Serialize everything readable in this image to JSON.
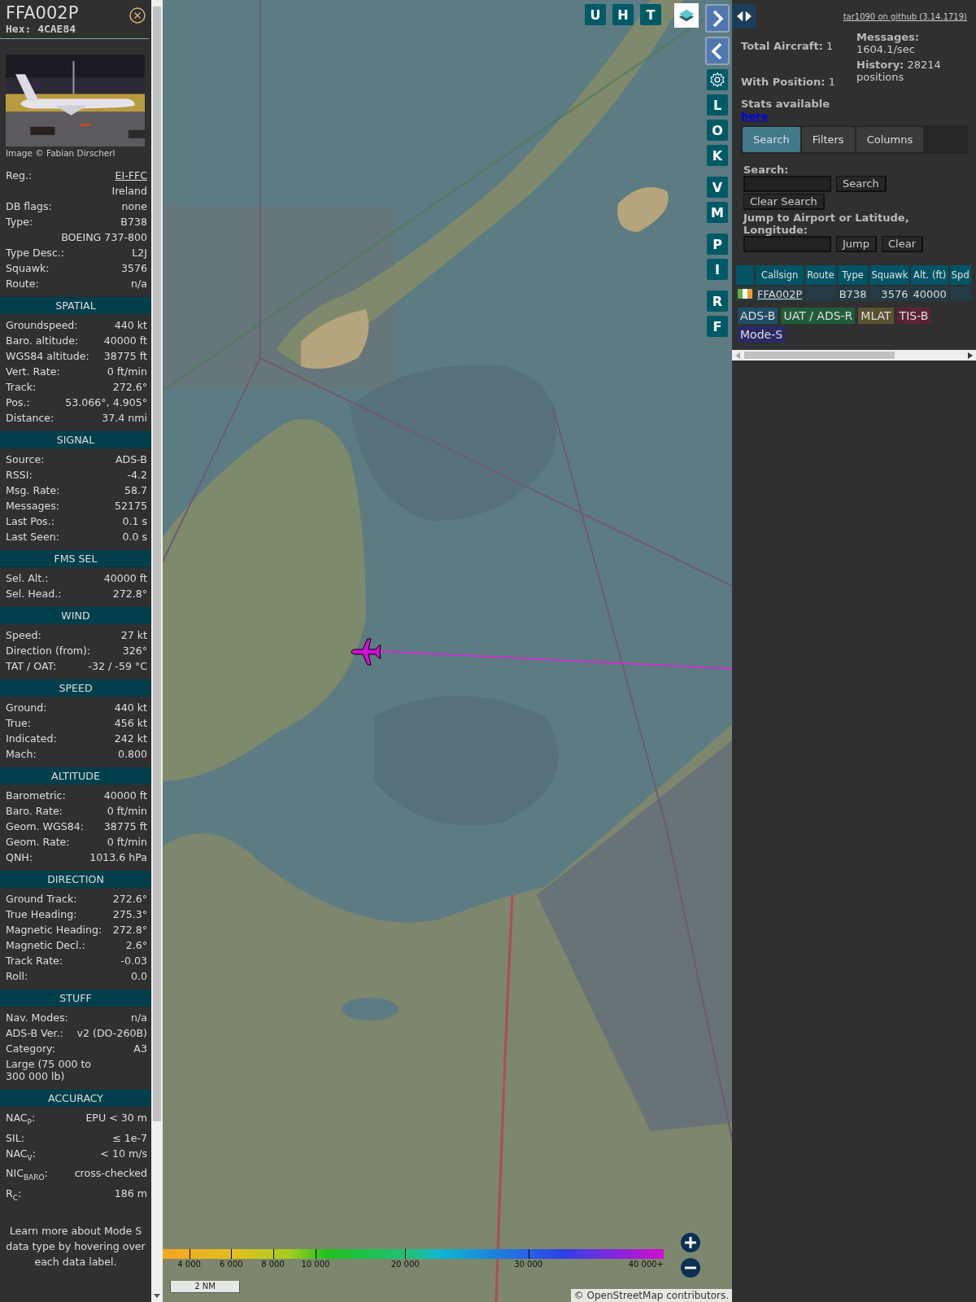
{
  "sidebar": {
    "callsign": "FFA002P",
    "hex_label": "Hex:",
    "hex": "4CAE84",
    "photo": {
      "kind": "picture"
    },
    "photo_credit": "Image © Fabian Dirscherl",
    "info_rows": [
      {
        "kind": "link",
        "label": "Reg.:",
        "value": "EI-FFC"
      },
      {
        "kind": "value",
        "value": "Ireland"
      },
      {
        "kind": "pair",
        "label": "DB flags:",
        "value": "none"
      },
      {
        "kind": "pair",
        "label": "Type:",
        "value": "B738"
      },
      {
        "kind": "value",
        "value": "BOEING 737-800"
      },
      {
        "kind": "pair",
        "label": "Type Desc.:",
        "value": "L2J"
      },
      {
        "kind": "pair",
        "label": "Squawk:",
        "value": "3576"
      },
      {
        "kind": "pair",
        "label": "Route:",
        "value": "n/a"
      }
    ],
    "sections": [
      {
        "title": "SPATIAL",
        "rows": [
          {
            "kind": "pair",
            "label": "Groundspeed:",
            "value": "440 kt"
          },
          {
            "kind": "pair",
            "label": "Baro. altitude:",
            "value": "40000 ft"
          },
          {
            "kind": "pair",
            "label": "WGS84 altitude:",
            "value": "38775 ft"
          },
          {
            "kind": "pair",
            "label": "Vert. Rate:",
            "value": "0 ft/min"
          },
          {
            "kind": "pair",
            "label": "Track:",
            "value": "272.6°"
          },
          {
            "kind": "pair",
            "label": "Pos.:",
            "value": "53.066°, 4.905°"
          },
          {
            "kind": "pair",
            "label": "Distance:",
            "value": "37.4 nmi"
          }
        ]
      },
      {
        "title": "SIGNAL",
        "rows": [
          {
            "kind": "pair",
            "label": "Source:",
            "value": "ADS-B"
          },
          {
            "kind": "pair",
            "label": "RSSI:",
            "value": "-4.2"
          },
          {
            "kind": "pair",
            "label": "Msg. Rate:",
            "value": "58.7"
          },
          {
            "kind": "pair",
            "label": "Messages:",
            "value": "52175"
          },
          {
            "kind": "pair",
            "label": "Last Pos.:",
            "value": "0.1 s"
          },
          {
            "kind": "pair",
            "label": "Last Seen:",
            "value": "0.0 s"
          }
        ]
      },
      {
        "title": "FMS SEL",
        "rows": [
          {
            "kind": "pair",
            "label": "Sel. Alt.:",
            "value": "40000 ft"
          },
          {
            "kind": "pair",
            "label": "Sel. Head.:",
            "value": "272.8°"
          }
        ]
      },
      {
        "title": "WIND",
        "rows": [
          {
            "kind": "pair",
            "label": "Speed:",
            "value": "27 kt"
          },
          {
            "kind": "pair",
            "label": "Direction (from):",
            "value": "326°"
          },
          {
            "kind": "pair",
            "label": "TAT / OAT:",
            "value": "-32 / -59 °C"
          }
        ]
      },
      {
        "title": "SPEED",
        "rows": [
          {
            "kind": "pair",
            "label": "Ground:",
            "value": "440 kt"
          },
          {
            "kind": "pair",
            "label": "True:",
            "value": "456 kt"
          },
          {
            "kind": "pair",
            "label": "Indicated:",
            "value": "242 kt"
          },
          {
            "kind": "pair",
            "label": "Mach:",
            "value": "0.800"
          }
        ]
      },
      {
        "title": "ALTITUDE",
        "rows": [
          {
            "kind": "pair",
            "label": "Barometric:",
            "value": "40000 ft"
          },
          {
            "kind": "pair",
            "label": "Baro. Rate:",
            "value": "0 ft/min"
          },
          {
            "kind": "pair",
            "label": "Geom. WGS84:",
            "value": "38775 ft"
          },
          {
            "kind": "pair",
            "label": "Geom. Rate:",
            "value": "0 ft/min"
          },
          {
            "kind": "pair",
            "label": "QNH:",
            "value": "1013.6 hPa"
          }
        ]
      },
      {
        "title": "DIRECTION",
        "rows": [
          {
            "kind": "pair",
            "label": "Ground Track:",
            "value": "272.6°"
          },
          {
            "kind": "pair",
            "label": "True Heading:",
            "value": "275.3°"
          },
          {
            "kind": "pair",
            "label": "Magnetic Heading:",
            "value": "272.8°"
          },
          {
            "kind": "pair",
            "label": "Magnetic Decl.:",
            "value": "2.6°"
          },
          {
            "kind": "pair",
            "label": "Track Rate:",
            "value": "-0.03"
          },
          {
            "kind": "pair",
            "label": "Roll:",
            "value": "0.0"
          }
        ]
      },
      {
        "title": "STUFF",
        "rows": [
          {
            "kind": "pair",
            "label": "Nav. Modes:",
            "value": "n/a"
          },
          {
            "kind": "pair",
            "label": "ADS-B Ver.:",
            "value": "v2 (DO-260B)"
          },
          {
            "kind": "pair",
            "label": "Category:",
            "value": "A3"
          },
          {
            "kind": "text",
            "value": "Large (75 000 to 300 000 lb)"
          }
        ]
      },
      {
        "title": "ACCURACY",
        "rows": [
          {
            "kind": "pair",
            "label": "NAC$_{P}$:",
            "value": "EPU < 30 m"
          },
          {
            "kind": "pair",
            "label": "SIL:",
            "value": "≤ 1e-7"
          },
          {
            "kind": "pair",
            "label": "NAC$_{V}$:",
            "value": "< 10 m/s"
          },
          {
            "kind": "pair",
            "label": "NIC$_{BARO}$:",
            "value": "cross-checked"
          },
          {
            "kind": "pair",
            "label": "R$_{C}$:",
            "value": "186 m"
          }
        ]
      }
    ],
    "note": "Learn more about Mode S data type by hovering over each data label."
  },
  "map": {
    "picture": {
      "kind": "picture"
    },
    "top_buttons": [
      "U",
      "H",
      "T"
    ],
    "side_button_groups": [
      [
        {
          "kind": "next"
        },
        {
          "kind": "prev"
        },
        {
          "kind": "settings"
        },
        {
          "kind": "letter",
          "label": "L"
        },
        {
          "kind": "letter",
          "label": "O"
        },
        {
          "kind": "letter",
          "label": "K"
        }
      ],
      [
        {
          "kind": "letter",
          "label": "V"
        },
        {
          "kind": "letter",
          "label": "M"
        }
      ],
      [
        {
          "kind": "letter",
          "label": "P"
        },
        {
          "kind": "letter",
          "label": "I"
        }
      ],
      [
        {
          "kind": "letter",
          "label": "R"
        },
        {
          "kind": "letter",
          "label": "F"
        }
      ]
    ],
    "altitude_legend": [
      "4 000",
      "6 000",
      "8 000",
      "10 000",
      "20 000",
      "30 000",
      "40 000+"
    ],
    "scale": "2 NM",
    "attribution": "© OpenStreetMap contributors."
  },
  "right_panel": {
    "github_link": "tar1090 on github (3.14.1719)",
    "stats_left": [
      {
        "label": "Total Aircraft:",
        "value": "1"
      },
      {
        "label": "With Position:",
        "value": "1"
      }
    ],
    "stats_right": [
      {
        "label": "Messages:",
        "value": "1604.1/sec"
      },
      {
        "label": "History:",
        "value": "28214 positions"
      }
    ],
    "stats_text": "Stats available",
    "stats_link": "here",
    "tabs": [
      {
        "label": "Search",
        "selected": true
      },
      {
        "label": "Filters",
        "selected": false
      },
      {
        "label": "Columns",
        "selected": false
      }
    ],
    "search_label": "Search:",
    "search_button": "Search",
    "clear_search_button": "Clear Search",
    "jump_label": "Jump to Airport or Latitude, Longitude:",
    "jump_button": "Jump",
    "clear_button": "Clear",
    "table": {
      "columns": [
        "Callsign",
        "Route",
        "Type",
        "Squawk",
        "Alt. (ft)",
        "Spd"
      ],
      "rows": [
        {
          "callsign": "FFA002P",
          "type": "B738",
          "squawk": "3576",
          "altitude": "40000"
        }
      ]
    },
    "legend": [
      {
        "label": "ADS-B",
        "color": "#1e4f66"
      },
      {
        "label": "UAT / ADS-R",
        "color": "#205c38"
      },
      {
        "label": "MLAT",
        "color": "#5a5230"
      },
      {
        "label": "TIS-B",
        "color": "#5c2236"
      },
      {
        "label": "Mode-S",
        "color": "#2a2a66"
      }
    ]
  }
}
